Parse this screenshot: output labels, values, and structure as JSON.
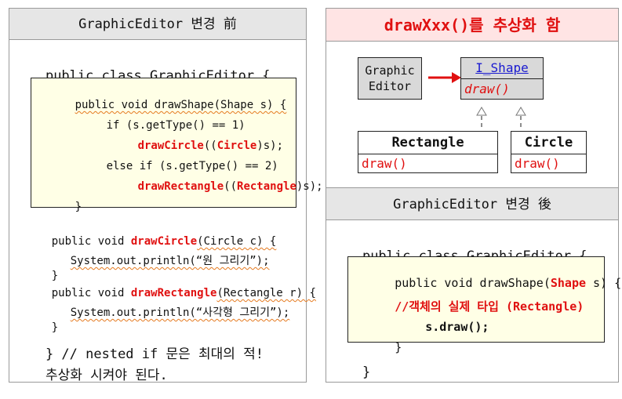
{
  "left": {
    "title": "GraphicEditor 변경 前",
    "class_decl": "public class GraphicEditor {",
    "method": {
      "sig": "public void drawShape(Shape s) {",
      "if1": "if (s.getType() == 1)",
      "call1": "drawCircle",
      "call1_args_open": "((",
      "call1_cast": "Circle",
      "call1_args_close": ")s);",
      "if2": "else if (s.getType() == 2)",
      "call2": "drawRectangle",
      "call2_args_open": "((",
      "call2_cast": "Rectangle",
      "call2_args_close": ")s);",
      "close": "}"
    },
    "m2_prefix": "public void ",
    "m2_name": "drawCircle",
    "m2_params": "(Circle c) {",
    "m2_body": "System.out.println(“원 그리기”);",
    "m2_close": "}",
    "m3_prefix": "public void ",
    "m3_name": "drawRectangle",
    "m3_params": "(Rectangle r) {",
    "m3_body": "System.out.println(“사각형 그리기”);",
    "m3_close": "}",
    "note1": "} // nested if 문은 최대의 적!",
    "note2": "추상화 시켜야 된다."
  },
  "right": {
    "title": "drawXxx()를 추상화 함",
    "uml": {
      "editor_line1": "Graphic",
      "editor_line2": "Editor",
      "interface_name": "I_Shape",
      "interface_method": "draw()",
      "rect_name": "Rectangle",
      "rect_method": "draw()",
      "circle_name": "Circle",
      "circle_method": "draw()"
    },
    "after_title": "GraphicEditor 변경 後",
    "class_decl": "public class GraphicEditor {",
    "method": {
      "sig_prefix": "public void drawShape(",
      "sig_type": "Shape",
      "sig_suffix": " s) {",
      "comment": "//객체의 실제 타입 (Rectangle)",
      "call": "s.draw();",
      "close": "}"
    },
    "class_close": "}"
  },
  "colors": {
    "accent_red": "#e01010",
    "header_gray": "#e6e6e6",
    "code_box_bg": "#ffffe6",
    "uml_gray": "#d9d9d9",
    "pink_header": "#ffe4e4"
  }
}
